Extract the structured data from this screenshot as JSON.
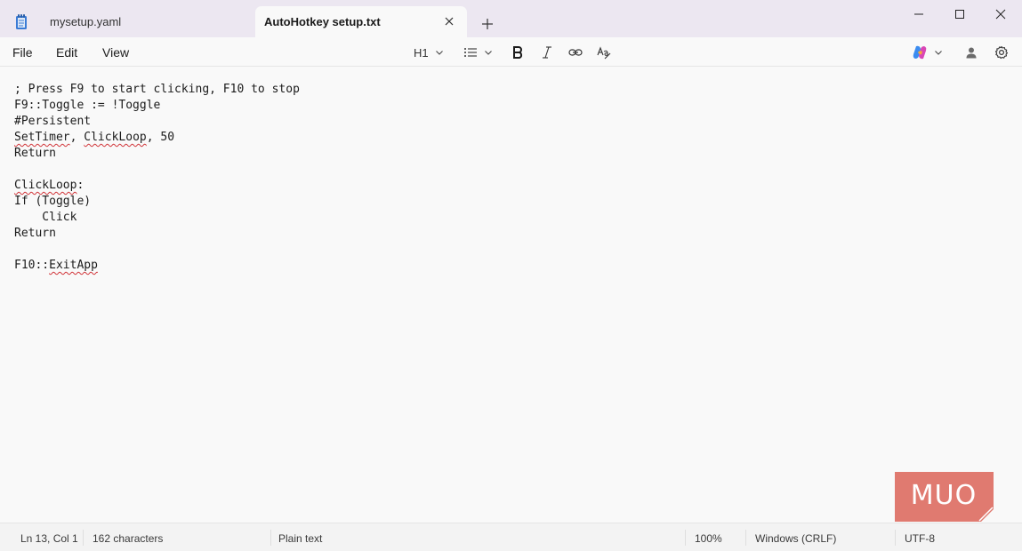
{
  "tabs": [
    {
      "label": "mysetup.yaml",
      "active": false
    },
    {
      "label": "AutoHotkey setup.txt",
      "active": true
    }
  ],
  "menu": {
    "file": "File",
    "edit": "Edit",
    "view": "View"
  },
  "toolbar": {
    "heading_label": "H1",
    "icons": [
      "list-icon",
      "bold-icon",
      "italic-icon",
      "link-icon",
      "clear-formatting-icon",
      "copilot-icon",
      "account-icon",
      "settings-icon"
    ]
  },
  "editor": {
    "lines": [
      [
        {
          "t": "; Press F9 to start clicking, F10 to stop"
        }
      ],
      [
        {
          "t": "F9::Toggle := !Toggle"
        }
      ],
      [
        {
          "t": "#Persistent"
        }
      ],
      [
        {
          "t": "SetTimer",
          "sq": true
        },
        {
          "t": ", "
        },
        {
          "t": "ClickLoop",
          "sq": true
        },
        {
          "t": ", 50"
        }
      ],
      [
        {
          "t": "Return"
        }
      ],
      [
        {
          "t": ""
        }
      ],
      [
        {
          "t": "ClickLoop",
          "sq": true
        },
        {
          "t": ":"
        }
      ],
      [
        {
          "t": "If (Toggle)"
        }
      ],
      [
        {
          "t": "    Click"
        }
      ],
      [
        {
          "t": "Return"
        }
      ],
      [
        {
          "t": ""
        }
      ],
      [
        {
          "t": "F10::"
        },
        {
          "t": "ExitApp",
          "sq": true
        }
      ]
    ]
  },
  "status": {
    "position": "Ln 13, Col 1",
    "characters": "162 characters",
    "format": "Plain text",
    "zoom": "100%",
    "line_ending": "Windows (CRLF)",
    "encoding": "UTF-8"
  },
  "watermark": {
    "text": "MUO"
  },
  "colors": {
    "titlebar": "#ece7f1",
    "editor_bg": "#f9f9f9",
    "spell_error": "#d13438",
    "logo": "#e07a70"
  }
}
